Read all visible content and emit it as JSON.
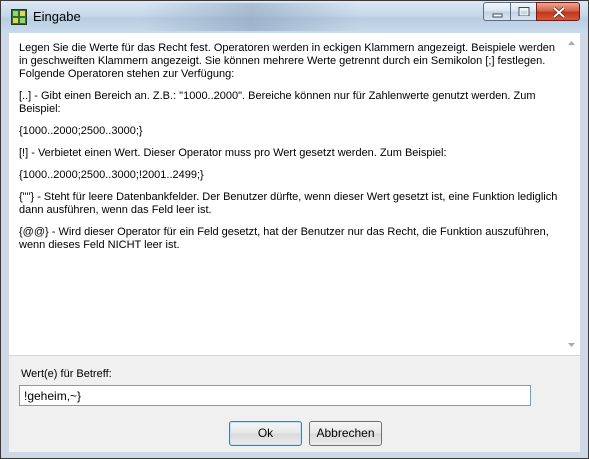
{
  "window": {
    "title": "Eingabe"
  },
  "caption": {
    "minimize": "minimize",
    "maximize": "maximize",
    "close": "close"
  },
  "info": {
    "paragraphs": [
      "Legen Sie die Werte für das Recht fest. Operatoren werden in eckigen Klammern angezeigt. Beispiele werden in geschweiften Klammern angezeigt. Sie können mehrere Werte getrennt durch ein Semikolon [;] festlegen. Folgende Operatoren stehen zur Verfügung:",
      "[..] - Gibt einen Bereich an. Z.B.: \"1000..2000\". Bereiche können nur für Zahlenwerte genutzt werden. Zum Beispiel:",
      "{1000..2000;2500..3000;}",
      "[!] - Verbietet einen Wert. Dieser Operator muss pro Wert gesetzt werden. Zum Beispiel:",
      "{1000..2000;2500..3000;!2001..2499;}",
      "{\"\"} - Steht für leere Datenbankfelder. Der Benutzer dürfte, wenn dieser Wert gesetzt ist, eine Funktion lediglich dann ausführen, wenn das Feld leer ist.",
      "{@@} - Wird dieser Operator für ein Feld gesetzt, hat der Benutzer nur das Recht, die Funktion auszuführen, wenn dieses Feld NICHT leer ist."
    ]
  },
  "form": {
    "label": "Wert(e) für Betreff:",
    "value": "!geheim,~}"
  },
  "buttons": {
    "ok": "Ok",
    "cancel": "Abbrechen"
  }
}
